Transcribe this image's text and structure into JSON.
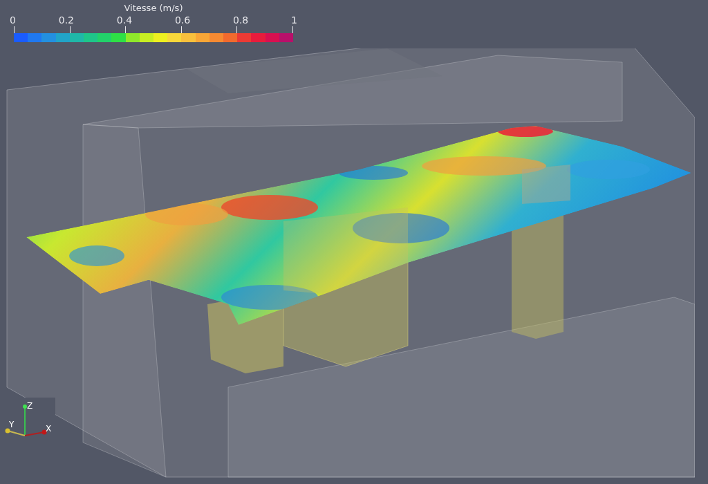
{
  "color_legend": {
    "title": "Vitesse (m/s)",
    "ticks": [
      "0",
      "0.2",
      "0.4",
      "0.6",
      "0.8",
      "1"
    ]
  },
  "orientation_axes": {
    "x_label": "X",
    "y_label": "Y",
    "z_label": "Z"
  }
}
